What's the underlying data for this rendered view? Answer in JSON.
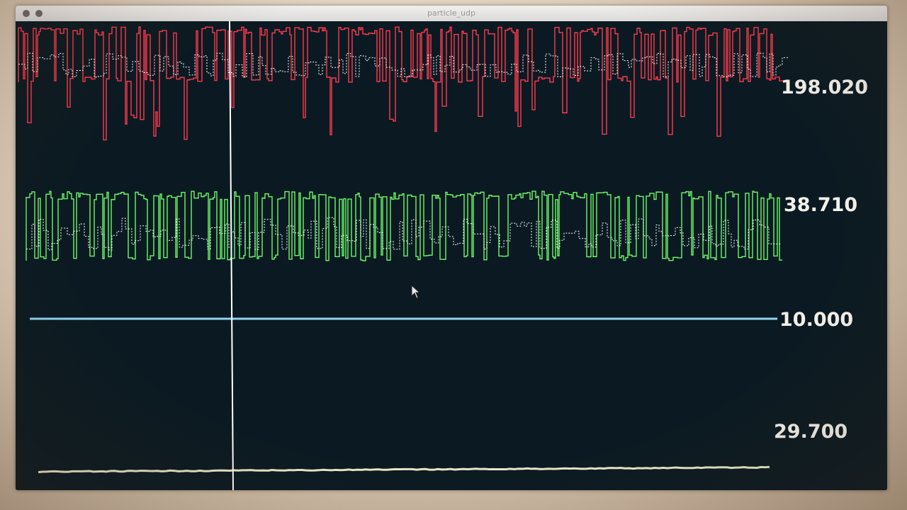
{
  "window": {
    "title": "particle_udp"
  },
  "traces": [
    {
      "id": "red",
      "color": "#ff3b4e",
      "readout": "198.020"
    },
    {
      "id": "green",
      "color": "#6cf86a",
      "readout": "38.710"
    },
    {
      "id": "blue",
      "color": "#8fd4f2",
      "readout": "10.000"
    },
    {
      "id": "yellow",
      "color": "#e7e6c6",
      "readout": "29.700"
    }
  ],
  "colors": {
    "plot_background": "#0b1a22",
    "cursor_line": "#ffffff",
    "readout_text": "#f4f1ea"
  },
  "icons": [
    "mouse-pointer-icon"
  ]
}
